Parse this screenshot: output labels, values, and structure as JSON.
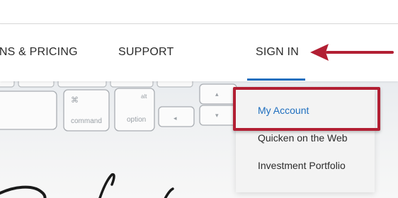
{
  "nav": {
    "items": [
      {
        "label": "ANS & PRICING"
      },
      {
        "label": "SUPPORT"
      },
      {
        "label": "SIGN IN"
      }
    ]
  },
  "dropdown": {
    "items": [
      {
        "label": "My Account"
      },
      {
        "label": "Quicken on the Web"
      },
      {
        "label": "Investment Portfolio"
      }
    ]
  },
  "keyboard": {
    "command_label": "command",
    "command_symbol": "⌘",
    "option_label": "option",
    "option_symbol": "alt",
    "left_arrow_symbol": "◂",
    "up_arrow_symbol": "▴",
    "down_arrow_symbol": "▾"
  },
  "colors": {
    "accent_blue": "#1f6fbf",
    "annotation_red": "#b21f33",
    "text": "#2b2b2b"
  }
}
